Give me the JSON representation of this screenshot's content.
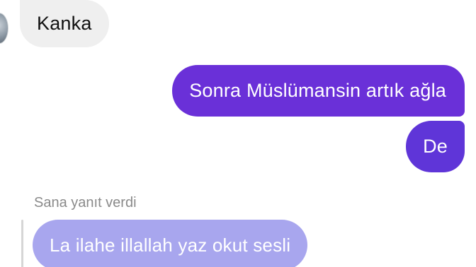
{
  "conversation": {
    "messages": [
      {
        "direction": "incoming",
        "text": "Kanka"
      },
      {
        "direction": "outgoing",
        "text": "Sonra Müslümansin artık ağla"
      },
      {
        "direction": "outgoing",
        "text": "De"
      }
    ],
    "reply": {
      "label": "Sana yanıt verdi",
      "text": "La ilahe illallah yaz okut sesli"
    }
  },
  "colors": {
    "incoming_bubble": "#efefef",
    "outgoing_bubble_top": "#6a30d8",
    "outgoing_bubble_bottom": "#5f35d8",
    "reply_bubble": "#a8a6ee",
    "reply_label": "#8a8a8a"
  },
  "icons": {
    "avatar": "contact-avatar"
  }
}
